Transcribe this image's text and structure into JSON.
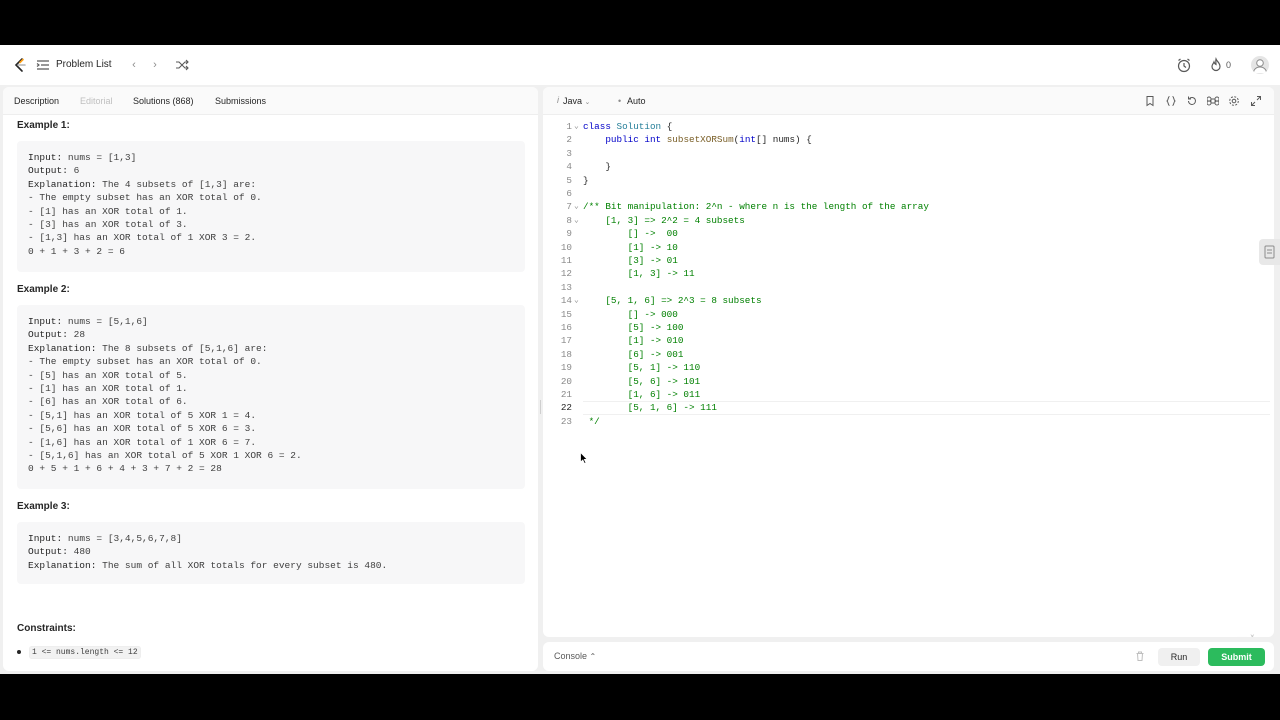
{
  "topnav": {
    "problem_list_label": "Problem List",
    "prev_icon": "chevron-left-icon",
    "next_icon": "chevron-right-icon",
    "shuffle_icon": "shuffle-icon",
    "timer_icon": "alarm-clock-icon",
    "streak_icon": "flame-icon",
    "streak_count": "0"
  },
  "left_tabs": [
    {
      "label": "Description"
    },
    {
      "label": "Editorial"
    },
    {
      "label": "Solutions (868)"
    },
    {
      "label": "Submissions"
    }
  ],
  "examples": [
    {
      "title": "Example 1:",
      "lines": [
        [
          "Input:",
          " nums = [1,3]"
        ],
        [
          "Output:",
          " 6"
        ],
        [
          "Explanation:",
          " The 4 subsets of [1,3] are:"
        ],
        [
          "",
          "- The empty subset has an XOR total of 0."
        ],
        [
          "",
          "- [1] has an XOR total of 1."
        ],
        [
          "",
          "- [3] has an XOR total of 3."
        ],
        [
          "",
          "- [1,3] has an XOR total of 1 XOR 3 = 2."
        ],
        [
          "",
          "0 + 1 + 3 + 2 = 6"
        ]
      ]
    },
    {
      "title": "Example 2:",
      "lines": [
        [
          "Input:",
          " nums = [5,1,6]"
        ],
        [
          "Output:",
          " 28"
        ],
        [
          "Explanation:",
          " The 8 subsets of [5,1,6] are:"
        ],
        [
          "",
          "- The empty subset has an XOR total of 0."
        ],
        [
          "",
          "- [5] has an XOR total of 5."
        ],
        [
          "",
          "- [1] has an XOR total of 1."
        ],
        [
          "",
          "- [6] has an XOR total of 6."
        ],
        [
          "",
          "- [5,1] has an XOR total of 5 XOR 1 = 4."
        ],
        [
          "",
          "- [5,6] has an XOR total of 5 XOR 6 = 3."
        ],
        [
          "",
          "- [1,6] has an XOR total of 1 XOR 6 = 7."
        ],
        [
          "",
          "- [5,1,6] has an XOR total of 5 XOR 1 XOR 6 = 2."
        ],
        [
          "",
          "0 + 5 + 1 + 6 + 4 + 3 + 7 + 2 = 28"
        ]
      ]
    },
    {
      "title": "Example 3:",
      "lines": [
        [
          "Input:",
          " nums = [3,4,5,6,7,8]"
        ],
        [
          "Output:",
          " 480"
        ],
        [
          "Explanation:",
          " The sum of all XOR totals for every subset is 480."
        ]
      ]
    }
  ],
  "constraints": {
    "title": "Constraints:",
    "items": [
      "1 <= nums.length <= 12"
    ]
  },
  "editor": {
    "language": "Java",
    "auto_label": "Auto",
    "current_line": 22,
    "code_lines": [
      {
        "n": "1",
        "fold": true,
        "tokens": [
          [
            "kw",
            "class "
          ],
          [
            "cls",
            "Solution"
          ],
          [
            "plain",
            " {"
          ]
        ]
      },
      {
        "n": "2",
        "tokens": [
          [
            "plain",
            "    "
          ],
          [
            "kw",
            "public int "
          ],
          [
            "fn",
            "subsetXORSum"
          ],
          [
            "plain",
            "("
          ],
          [
            "kw",
            "int"
          ],
          [
            "plain",
            "[] nums) {"
          ]
        ]
      },
      {
        "n": "3",
        "tokens": []
      },
      {
        "n": "4",
        "tokens": [
          [
            "plain",
            "    }"
          ]
        ]
      },
      {
        "n": "5",
        "tokens": [
          [
            "plain",
            "}"
          ]
        ]
      },
      {
        "n": "6",
        "tokens": []
      },
      {
        "n": "7",
        "fold": true,
        "tokens": [
          [
            "cm",
            "/** Bit manipulation: 2^n - where n is the length of the array"
          ]
        ]
      },
      {
        "n": "8",
        "fold": true,
        "tokens": [
          [
            "cm",
            "    [1, 3] => 2^2 = 4 subsets"
          ]
        ]
      },
      {
        "n": "9",
        "tokens": [
          [
            "cm",
            "        [] ->  00"
          ]
        ]
      },
      {
        "n": "10",
        "tokens": [
          [
            "cm",
            "        [1] -> 10"
          ]
        ]
      },
      {
        "n": "11",
        "tokens": [
          [
            "cm",
            "        [3] -> 01"
          ]
        ]
      },
      {
        "n": "12",
        "tokens": [
          [
            "cm",
            "        [1, 3] -> 11"
          ]
        ]
      },
      {
        "n": "13",
        "tokens": []
      },
      {
        "n": "14",
        "fold": true,
        "tokens": [
          [
            "cm",
            "    [5, 1, 6] => 2^3 = 8 subsets"
          ]
        ]
      },
      {
        "n": "15",
        "tokens": [
          [
            "cm",
            "        [] -> 000"
          ]
        ]
      },
      {
        "n": "16",
        "tokens": [
          [
            "cm",
            "        [5] -> 100"
          ]
        ]
      },
      {
        "n": "17",
        "tokens": [
          [
            "cm",
            "        [1] -> 010"
          ]
        ]
      },
      {
        "n": "18",
        "tokens": [
          [
            "cm",
            "        [6] -> 001"
          ]
        ]
      },
      {
        "n": "19",
        "tokens": [
          [
            "cm",
            "        [5, 1] -> 110"
          ]
        ]
      },
      {
        "n": "20",
        "tokens": [
          [
            "cm",
            "        [5, 6] -> 101"
          ]
        ]
      },
      {
        "n": "21",
        "tokens": [
          [
            "cm",
            "        [1, 6] -> 011"
          ]
        ]
      },
      {
        "n": "22",
        "tokens": [
          [
            "cm",
            "        [5, 1, 6] -> 111"
          ]
        ]
      },
      {
        "n": "23",
        "tokens": [
          [
            "cm",
            " */"
          ]
        ]
      }
    ]
  },
  "console": {
    "label": "Console",
    "run_label": "Run",
    "submit_label": "Submit"
  },
  "colors": {
    "submit_green": "#2cbb5d",
    "keyword_blue": "#0000c8",
    "comment_green": "#008000"
  }
}
